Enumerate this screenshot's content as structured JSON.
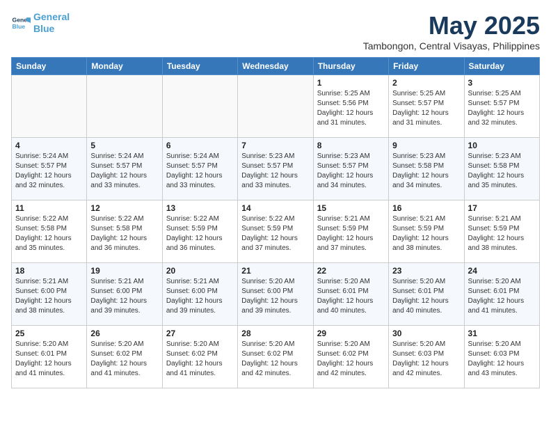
{
  "logo": {
    "line1": "General",
    "line2": "Blue"
  },
  "title": "May 2025",
  "location": "Tambongon, Central Visayas, Philippines",
  "days_of_week": [
    "Sunday",
    "Monday",
    "Tuesday",
    "Wednesday",
    "Thursday",
    "Friday",
    "Saturday"
  ],
  "weeks": [
    [
      {
        "day": "",
        "info": ""
      },
      {
        "day": "",
        "info": ""
      },
      {
        "day": "",
        "info": ""
      },
      {
        "day": "",
        "info": ""
      },
      {
        "day": "1",
        "info": "Sunrise: 5:25 AM\nSunset: 5:56 PM\nDaylight: 12 hours\nand 31 minutes."
      },
      {
        "day": "2",
        "info": "Sunrise: 5:25 AM\nSunset: 5:57 PM\nDaylight: 12 hours\nand 31 minutes."
      },
      {
        "day": "3",
        "info": "Sunrise: 5:25 AM\nSunset: 5:57 PM\nDaylight: 12 hours\nand 32 minutes."
      }
    ],
    [
      {
        "day": "4",
        "info": "Sunrise: 5:24 AM\nSunset: 5:57 PM\nDaylight: 12 hours\nand 32 minutes."
      },
      {
        "day": "5",
        "info": "Sunrise: 5:24 AM\nSunset: 5:57 PM\nDaylight: 12 hours\nand 33 minutes."
      },
      {
        "day": "6",
        "info": "Sunrise: 5:24 AM\nSunset: 5:57 PM\nDaylight: 12 hours\nand 33 minutes."
      },
      {
        "day": "7",
        "info": "Sunrise: 5:23 AM\nSunset: 5:57 PM\nDaylight: 12 hours\nand 33 minutes."
      },
      {
        "day": "8",
        "info": "Sunrise: 5:23 AM\nSunset: 5:57 PM\nDaylight: 12 hours\nand 34 minutes."
      },
      {
        "day": "9",
        "info": "Sunrise: 5:23 AM\nSunset: 5:58 PM\nDaylight: 12 hours\nand 34 minutes."
      },
      {
        "day": "10",
        "info": "Sunrise: 5:23 AM\nSunset: 5:58 PM\nDaylight: 12 hours\nand 35 minutes."
      }
    ],
    [
      {
        "day": "11",
        "info": "Sunrise: 5:22 AM\nSunset: 5:58 PM\nDaylight: 12 hours\nand 35 minutes."
      },
      {
        "day": "12",
        "info": "Sunrise: 5:22 AM\nSunset: 5:58 PM\nDaylight: 12 hours\nand 36 minutes."
      },
      {
        "day": "13",
        "info": "Sunrise: 5:22 AM\nSunset: 5:59 PM\nDaylight: 12 hours\nand 36 minutes."
      },
      {
        "day": "14",
        "info": "Sunrise: 5:22 AM\nSunset: 5:59 PM\nDaylight: 12 hours\nand 37 minutes."
      },
      {
        "day": "15",
        "info": "Sunrise: 5:21 AM\nSunset: 5:59 PM\nDaylight: 12 hours\nand 37 minutes."
      },
      {
        "day": "16",
        "info": "Sunrise: 5:21 AM\nSunset: 5:59 PM\nDaylight: 12 hours\nand 38 minutes."
      },
      {
        "day": "17",
        "info": "Sunrise: 5:21 AM\nSunset: 5:59 PM\nDaylight: 12 hours\nand 38 minutes."
      }
    ],
    [
      {
        "day": "18",
        "info": "Sunrise: 5:21 AM\nSunset: 6:00 PM\nDaylight: 12 hours\nand 38 minutes."
      },
      {
        "day": "19",
        "info": "Sunrise: 5:21 AM\nSunset: 6:00 PM\nDaylight: 12 hours\nand 39 minutes."
      },
      {
        "day": "20",
        "info": "Sunrise: 5:21 AM\nSunset: 6:00 PM\nDaylight: 12 hours\nand 39 minutes."
      },
      {
        "day": "21",
        "info": "Sunrise: 5:20 AM\nSunset: 6:00 PM\nDaylight: 12 hours\nand 39 minutes."
      },
      {
        "day": "22",
        "info": "Sunrise: 5:20 AM\nSunset: 6:01 PM\nDaylight: 12 hours\nand 40 minutes."
      },
      {
        "day": "23",
        "info": "Sunrise: 5:20 AM\nSunset: 6:01 PM\nDaylight: 12 hours\nand 40 minutes."
      },
      {
        "day": "24",
        "info": "Sunrise: 5:20 AM\nSunset: 6:01 PM\nDaylight: 12 hours\nand 41 minutes."
      }
    ],
    [
      {
        "day": "25",
        "info": "Sunrise: 5:20 AM\nSunset: 6:01 PM\nDaylight: 12 hours\nand 41 minutes."
      },
      {
        "day": "26",
        "info": "Sunrise: 5:20 AM\nSunset: 6:02 PM\nDaylight: 12 hours\nand 41 minutes."
      },
      {
        "day": "27",
        "info": "Sunrise: 5:20 AM\nSunset: 6:02 PM\nDaylight: 12 hours\nand 41 minutes."
      },
      {
        "day": "28",
        "info": "Sunrise: 5:20 AM\nSunset: 6:02 PM\nDaylight: 12 hours\nand 42 minutes."
      },
      {
        "day": "29",
        "info": "Sunrise: 5:20 AM\nSunset: 6:02 PM\nDaylight: 12 hours\nand 42 minutes."
      },
      {
        "day": "30",
        "info": "Sunrise: 5:20 AM\nSunset: 6:03 PM\nDaylight: 12 hours\nand 42 minutes."
      },
      {
        "day": "31",
        "info": "Sunrise: 5:20 AM\nSunset: 6:03 PM\nDaylight: 12 hours\nand 43 minutes."
      }
    ]
  ]
}
